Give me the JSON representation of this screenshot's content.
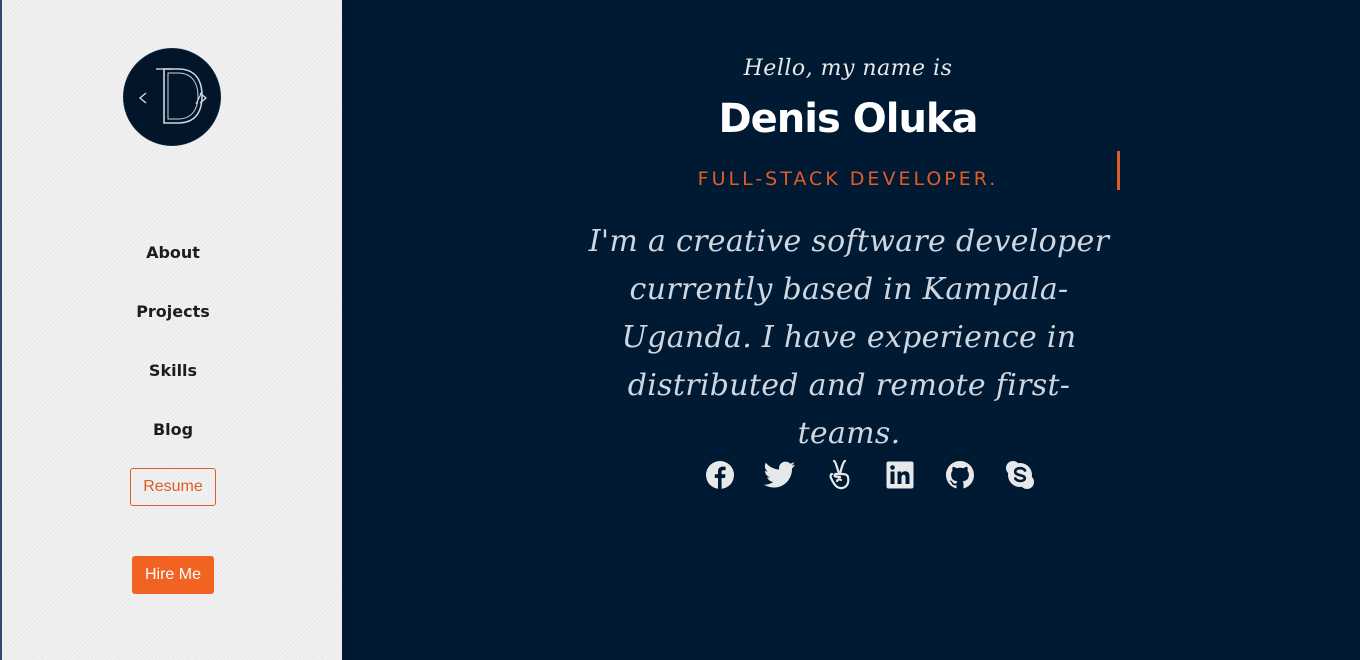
{
  "sidebar": {
    "logo": {
      "icon": "logo-d-code-icon",
      "letter": "D"
    },
    "nav": [
      {
        "label": "About"
      },
      {
        "label": "Projects"
      },
      {
        "label": "Skills"
      },
      {
        "label": "Blog"
      }
    ],
    "resume_label": "Resume",
    "hire_label": "Hire Me"
  },
  "hero": {
    "greeting": "Hello, my name is",
    "name": "Denis Oluka",
    "role": "FULL-STACK DEVELOPER.",
    "bio": "I'm a creative software developer currently based in Kampala-Uganda. I have experience in distributed and remote first-teams."
  },
  "socials": [
    {
      "icon": "facebook-icon"
    },
    {
      "icon": "twitter-icon"
    },
    {
      "icon": "angellist-icon"
    },
    {
      "icon": "linkedin-icon"
    },
    {
      "icon": "github-icon"
    },
    {
      "icon": "skype-icon"
    }
  ],
  "colors": {
    "accent": "#f26322",
    "background": "#011a33",
    "sidebar": "#f1f1f1"
  }
}
